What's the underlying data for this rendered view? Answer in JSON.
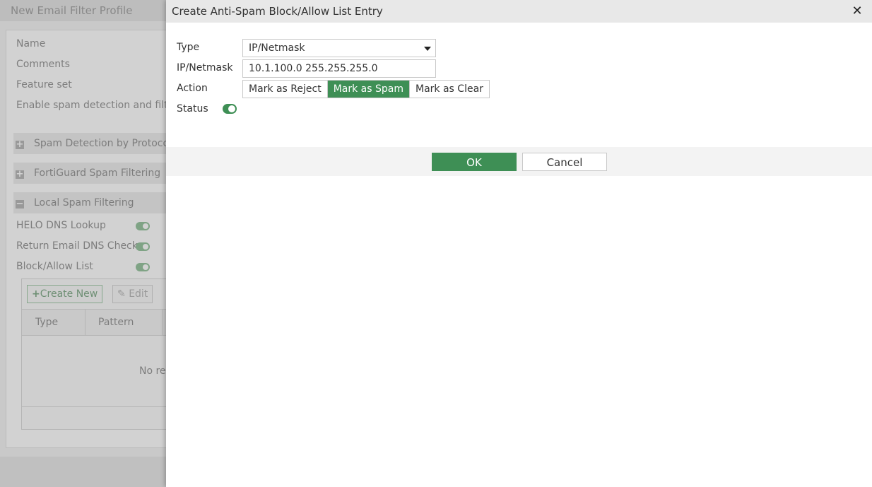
{
  "background": {
    "header_title": "New Email Filter Profile",
    "fields": [
      "Name",
      "Comments",
      "Feature set",
      "Enable spam detection and filtering"
    ],
    "sections": [
      {
        "label": "Spam Detection by Protocol",
        "state": "collapsed"
      },
      {
        "label": "FortiGuard Spam Filtering",
        "state": "collapsed"
      },
      {
        "label": "Local Spam Filtering",
        "state": "expanded"
      }
    ],
    "local_items": [
      {
        "label": "HELO DNS Lookup",
        "enabled": true
      },
      {
        "label": "Return Email DNS Check",
        "enabled": true
      },
      {
        "label": "Block/Allow List",
        "enabled": true
      }
    ],
    "table": {
      "create_label": "Create New",
      "edit_label": "Edit",
      "columns": [
        "Type",
        "Pattern"
      ],
      "empty_text": "No re"
    }
  },
  "dialog": {
    "title": "Create Anti-Spam Block/Allow List Entry",
    "type": {
      "label": "Type",
      "value": "IP/Netmask"
    },
    "ipnetmask": {
      "label": "IP/Netmask",
      "value": "10.1.100.0 255.255.255.0"
    },
    "action": {
      "label": "Action",
      "options": [
        "Mark as Reject",
        "Mark as Spam",
        "Mark as Clear"
      ],
      "selected": "Mark as Spam"
    },
    "status": {
      "label": "Status",
      "enabled": true
    },
    "ok_label": "OK",
    "cancel_label": "Cancel",
    "accent_color": "#3e8f55"
  }
}
